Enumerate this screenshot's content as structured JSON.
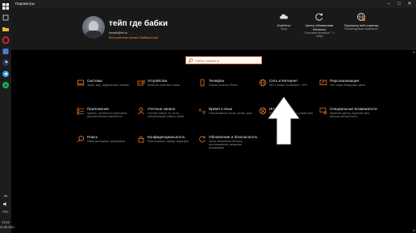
{
  "window": {
    "title": "Параметры"
  },
  "taskbar": {
    "icons": [
      "file-explorer-icon",
      "folder-icon",
      "opera-icon",
      "apps-icon",
      "steam-icon",
      "telegram-icon",
      "spotify-icon"
    ],
    "tray": {
      "language": "РУС",
      "time": "21:24",
      "date": "21.05.2021"
    }
  },
  "header": {
    "username": "тейп где бабки",
    "email": "bassit@bk.ru",
    "account_link": "Моя учетная запись Майкрософт",
    "items": [
      {
        "title": "OneDrive",
        "subtitle": "Вход",
        "icon": "cloud-icon"
      },
      {
        "title": "Центр обновления Windows",
        "subtitle": "Последняя проверка: 7 ч назад",
        "icon": "update-icon"
      },
      {
        "title": "Просмотр веб-страниц",
        "subtitle": "Рекомендуемые параметры",
        "icon": "globe-icon"
      }
    ]
  },
  "search": {
    "placeholder": "Найти параметр"
  },
  "tiles": [
    {
      "title": "Система",
      "desc": "Экран, звук, уведомления, питание",
      "icon": "laptop-icon"
    },
    {
      "title": "Устройства",
      "desc": "Bluetooth, принтеры, мышь",
      "icon": "keyboard-icon"
    },
    {
      "title": "Телефон",
      "desc": "Связать Android, iPhone",
      "icon": "phone-icon"
    },
    {
      "title": "Сеть и Интернет",
      "desc": "Wi-Fi, режим \"в самолете\", VPN",
      "icon": "network-globe-icon"
    },
    {
      "title": "Персонализация",
      "desc": "Фон, экран блокировки, цвета",
      "icon": "personalization-icon"
    },
    {
      "title": "Приложения",
      "desc": "Удалить, значения по умолчанию, дополнительные компоненты",
      "icon": "apps-list-icon"
    },
    {
      "title": "Учетные записи",
      "desc": "Учетные записи, эл. почта, синхронизация, работа, семья",
      "icon": "person-icon"
    },
    {
      "title": "Время и язык",
      "desc": "Распознавание голоса, регион, дата",
      "icon": "time-language-icon"
    },
    {
      "title": "Игры",
      "desc": "Xbox Game Bar, снимки, режим игры",
      "icon": "xbox-icon"
    },
    {
      "title": "Специальные возможности",
      "desc": "Экранный диктор, экранная лупа, высокая контрастность",
      "icon": "accessibility-icon"
    },
    {
      "title": "Поиск",
      "desc": "Найти мои файлы, разрешения",
      "icon": "search-icon"
    },
    {
      "title": "Конфиденциальность",
      "desc": "Расположение, камера, микрофон",
      "icon": "lock-icon"
    },
    {
      "title": "Обновление и безопасность",
      "desc": "Центр обновления Windows, восстановление, резервное копирование",
      "icon": "update-icon"
    }
  ],
  "colors": {
    "accent": "#f07a2c",
    "background": "#000000",
    "header": "#191919",
    "taskbar": "#1c1c1c"
  }
}
